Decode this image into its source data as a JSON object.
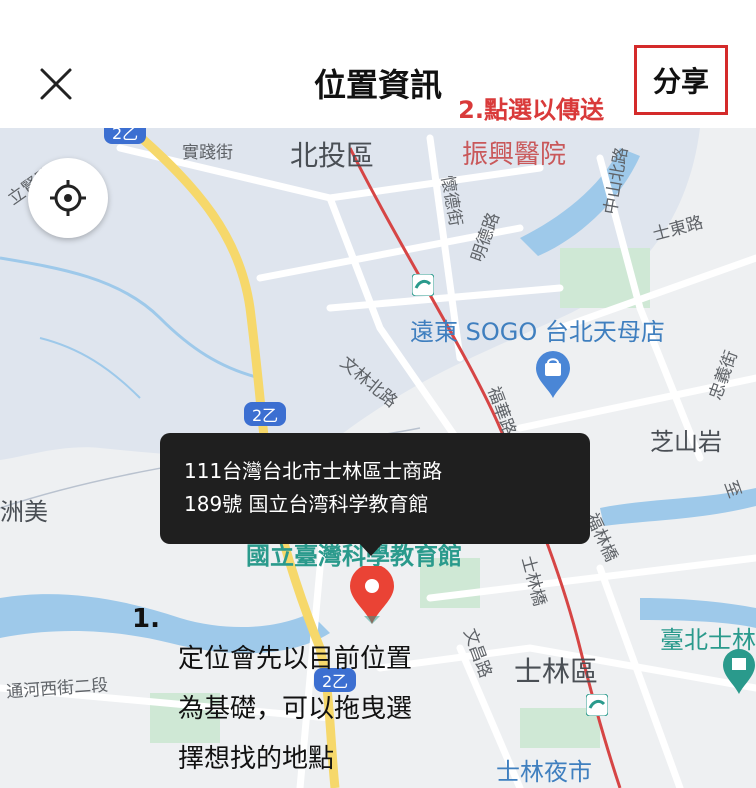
{
  "header": {
    "title": "位置資訊",
    "share_label": "分享",
    "share_hint": "2.點選以傳送"
  },
  "icons": {
    "close": "close-icon",
    "locate": "crosshair-icon",
    "pin": "map-pin-icon",
    "shopping": "shopping-bag-icon",
    "metro": "metro-icon"
  },
  "map": {
    "district_labels": [
      "北投區",
      "士林區",
      "芝山岩",
      "洲美"
    ],
    "streets": [
      "實踐街",
      "懷德街",
      "明德路",
      "中山北路",
      "士東路",
      "文林北路",
      "福華路",
      "福林橋",
      "士林橋",
      "文昌路",
      "通河西街二段",
      "忠義街",
      "至",
      "立賢路"
    ],
    "pois": {
      "hospital": "振興醫院",
      "mall": "遠東 SOGO 台北天母店",
      "museum": "國立臺灣科學教育館",
      "market": "士林夜市",
      "partial": "臺北士林"
    },
    "route_badges": [
      "2乙",
      "2乙",
      "2乙"
    ]
  },
  "tooltip": {
    "line1": "111台灣台北市士林區士商路",
    "line2": "189號 国立台湾科学教育館"
  },
  "annotation": {
    "number": "1.",
    "line1": "定位會先以目前位置",
    "line2": "為基礎，可以拖曳選",
    "line3": "擇想找的地點"
  },
  "colors": {
    "accent_red": "#d42a2a",
    "pin_red": "#ea4335",
    "water": "#9ec9ea",
    "park": "#cfe8d5",
    "tooltip_bg": "#1f1f1f",
    "road_yellow": "#f6d86b",
    "rail_red": "#d64545"
  }
}
